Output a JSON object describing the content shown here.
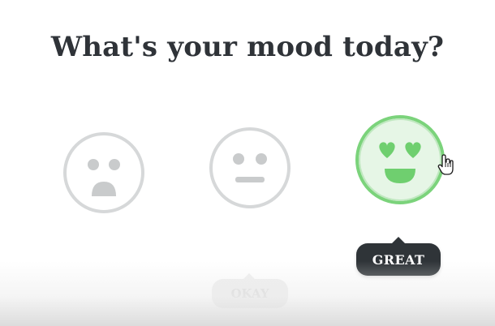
{
  "heading": "What's your mood today?",
  "moods": [
    {
      "name": "sad",
      "state": "idle"
    },
    {
      "name": "okay",
      "state": "idle"
    },
    {
      "name": "great",
      "state": "hover"
    }
  ],
  "tooltip": {
    "label": "GREAT"
  },
  "ghost_tooltip": {
    "label": "OKAY"
  },
  "colors": {
    "face_idle": "#d6d8d9",
    "face_idle_features": "#c9cbcc",
    "face_active_border": "#7bd37b",
    "face_active_fill": "#e6f6e6",
    "face_active_features": "#6fcf6f",
    "tooltip_bg": "#2f3438",
    "title": "#2f3338"
  },
  "icons": {
    "sad": "sad-face-icon",
    "okay": "neutral-face-icon",
    "great": "heart-eyes-face-icon",
    "cursor": "hand-pointer-icon"
  }
}
